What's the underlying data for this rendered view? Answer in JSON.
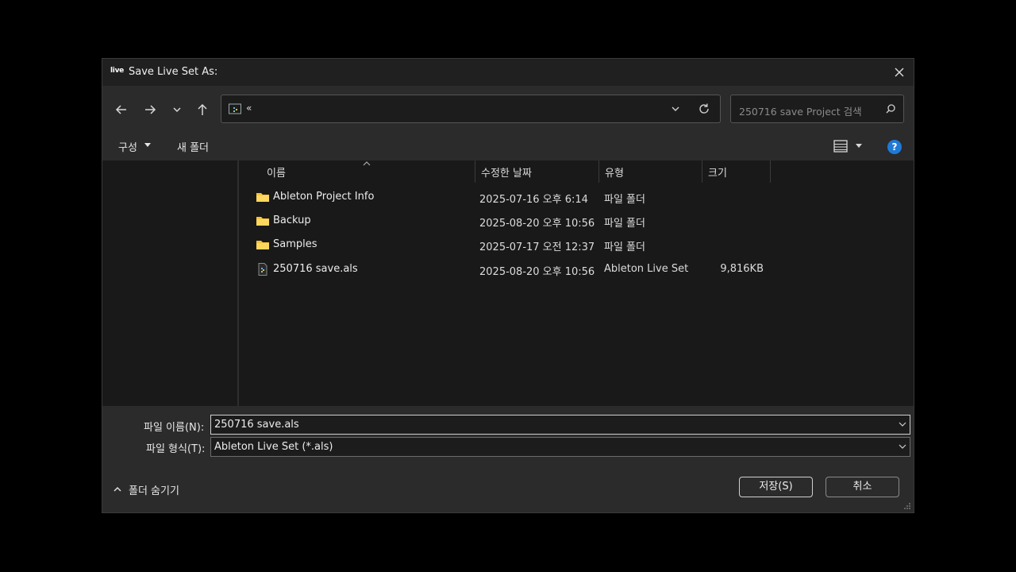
{
  "window": {
    "app_logo": "live",
    "title": "Save Live Set As:"
  },
  "nav": {
    "address_text": "«",
    "search_placeholder": "250716 save Project 검색"
  },
  "toolbar": {
    "organize_label": "구성",
    "new_folder_label": "새 폴더",
    "help_label": "?"
  },
  "columns": {
    "name": "이름",
    "date": "수정한 날짜",
    "type": "유형",
    "size": "크기"
  },
  "files": [
    {
      "name": "Ableton Project Info",
      "date": "2025-07-16 오후 6:14",
      "type": "파일 폴더",
      "size": "",
      "icon": "folder-icon"
    },
    {
      "name": "Backup",
      "date": "2025-08-20 오후 10:56",
      "type": "파일 폴더",
      "size": "",
      "icon": "folder-icon"
    },
    {
      "name": "Samples",
      "date": "2025-07-17 오전 12:37",
      "type": "파일 폴더",
      "size": "",
      "icon": "folder-icon"
    },
    {
      "name": "250716 save.als",
      "date": "2025-08-20 오후 10:56",
      "type": "Ableton Live Set",
      "size": "9,816KB",
      "icon": "als-file-icon"
    }
  ],
  "bottom": {
    "filename_label": "파일 이름(N):",
    "filename_value": "250716 save.als",
    "filetype_label": "파일 형식(T):",
    "filetype_value": "Ableton Live Set (*.als)",
    "hide_folders_label": "폴더 숨기기",
    "save_label": "저장(S)",
    "cancel_label": "취소"
  },
  "colors": {
    "folder": "#f5c33b",
    "accent": "#1f7ad6",
    "background": "#202020"
  }
}
